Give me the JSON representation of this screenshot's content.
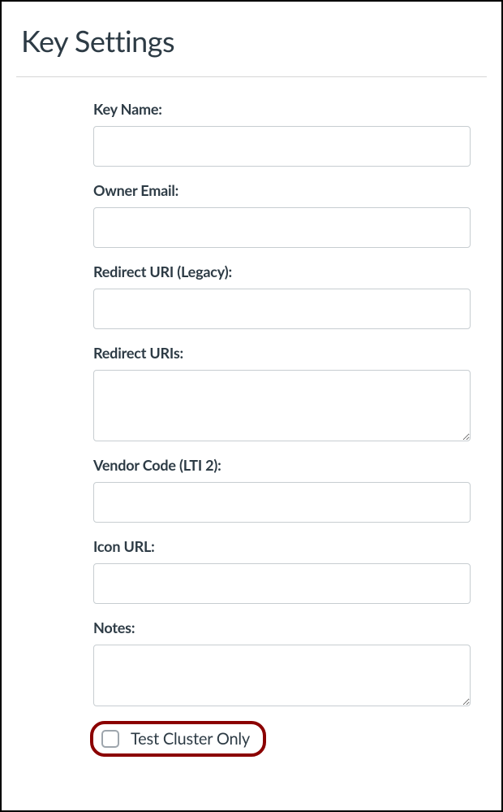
{
  "header": {
    "title": "Key Settings"
  },
  "form": {
    "keyName": {
      "label": "Key Name:",
      "value": ""
    },
    "ownerEmail": {
      "label": "Owner Email:",
      "value": ""
    },
    "redirectUriLegacy": {
      "label": "Redirect URI (Legacy):",
      "value": ""
    },
    "redirectUris": {
      "label": "Redirect URIs:",
      "value": ""
    },
    "vendorCode": {
      "label": "Vendor Code (LTI 2):",
      "value": ""
    },
    "iconUrl": {
      "label": "Icon URL:",
      "value": ""
    },
    "notes": {
      "label": "Notes:",
      "value": ""
    },
    "testClusterOnly": {
      "label": "Test Cluster Only",
      "checked": false
    }
  }
}
